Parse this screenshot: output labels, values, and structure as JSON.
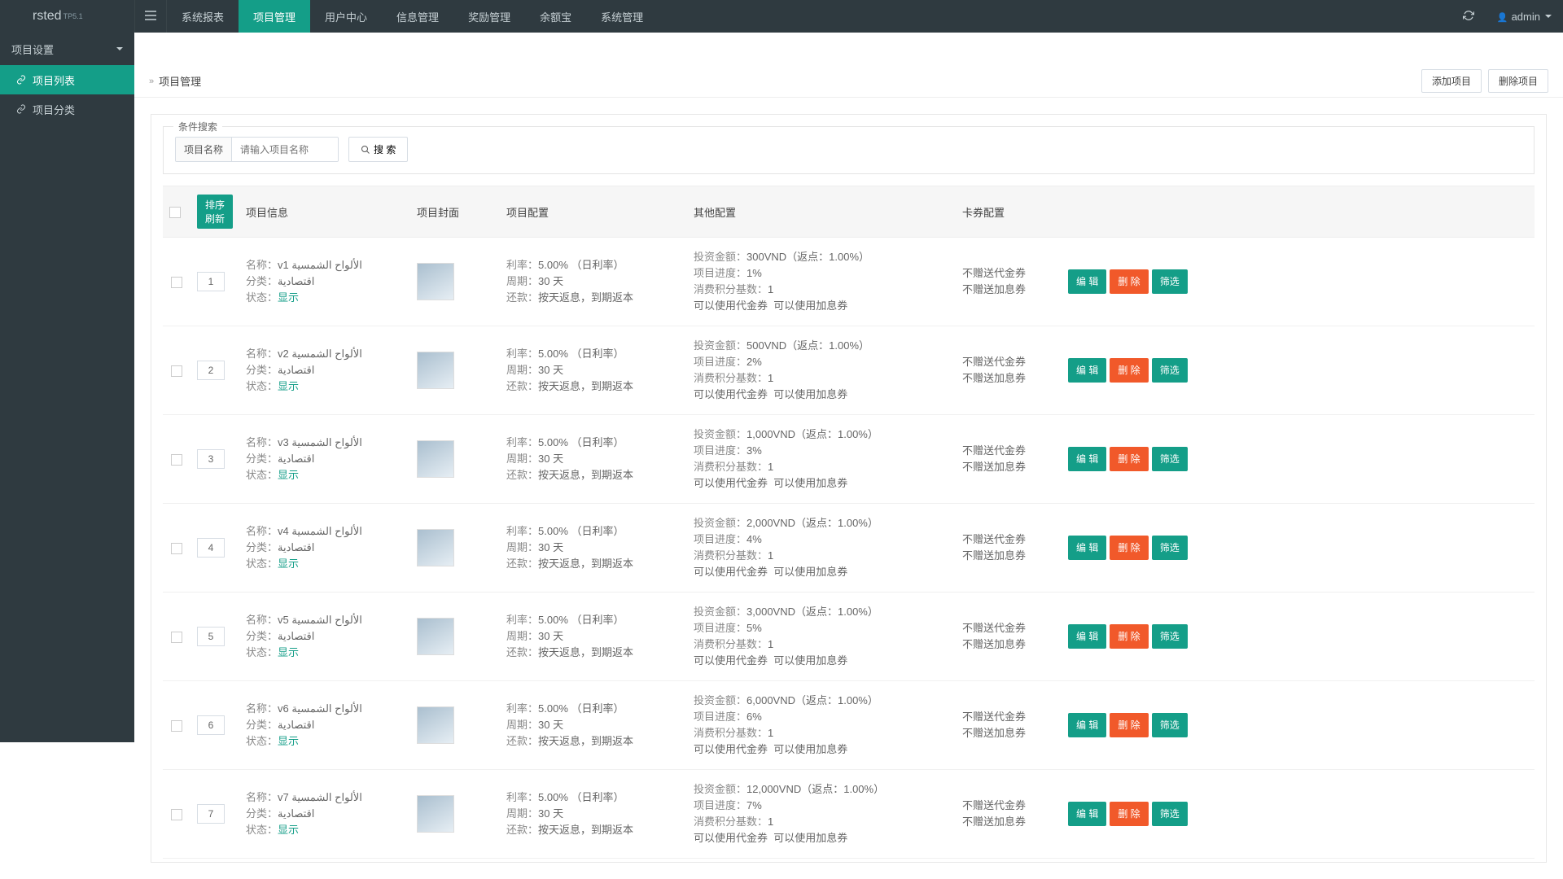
{
  "brand": {
    "name": "rsted",
    "version": "TP5.1"
  },
  "nav": {
    "items": [
      "系统报表",
      "项目管理",
      "用户中心",
      "信息管理",
      "奖励管理",
      "余额宝",
      "系统管理"
    ],
    "active_index": 1
  },
  "user": {
    "name": "admin"
  },
  "sidebar": {
    "header": "项目设置",
    "items": [
      {
        "label": "项目列表",
        "active": true
      },
      {
        "label": "项目分类",
        "active": false
      }
    ]
  },
  "breadcrumb": {
    "title": "项目管理"
  },
  "header_actions": {
    "add": "添加项目",
    "delete": "删除项目"
  },
  "search": {
    "legend": "条件搜索",
    "field_label": "项目名称",
    "placeholder": "请输入项目名称",
    "button": "搜 索"
  },
  "table": {
    "sort_refresh": "排序刷新",
    "headers": {
      "info": "项目信息",
      "cover": "项目封面",
      "config": "项目配置",
      "other": "其他配置",
      "card": "卡券配置"
    },
    "labels": {
      "name": "名称：",
      "category": "分类：",
      "status": "状态：",
      "status_show": "显示",
      "rate": "利率：",
      "rate_suffix": "（日利率）",
      "cycle": "周期：",
      "cycle_unit": " 天",
      "repay": "还款：",
      "repay_text": "按天返息，到期返本",
      "invest": "投资金额：",
      "rebate_prefix": "（返点：",
      "rebate_suffix": "）",
      "progress": "项目进度：",
      "consume": "消费积分基数：",
      "can_voucher": "可以使用代金券",
      "can_interest": "可以使用加息券",
      "no_voucher": "不赠送代金券",
      "no_interest": "不赠送加息券"
    },
    "actions": {
      "edit": "编 辑",
      "delete": "删 除",
      "filter": "筛选"
    },
    "rows": [
      {
        "sort": "1",
        "name": "الألواح الشمسية v1",
        "category": "اقتصادية",
        "rate": "5.00%",
        "cycle": "30",
        "invest": "300VND",
        "rebate": "1.00%",
        "progress": "1%",
        "consume": "1"
      },
      {
        "sort": "2",
        "name": "الألواح الشمسية v2",
        "category": "اقتصادية",
        "rate": "5.00%",
        "cycle": "30",
        "invest": "500VND",
        "rebate": "1.00%",
        "progress": "2%",
        "consume": "1"
      },
      {
        "sort": "3",
        "name": "الألواح الشمسية v3",
        "category": "اقتصادية",
        "rate": "5.00%",
        "cycle": "30",
        "invest": "1,000VND",
        "rebate": "1.00%",
        "progress": "3%",
        "consume": "1"
      },
      {
        "sort": "4",
        "name": "الألواح الشمسية v4",
        "category": "اقتصادية",
        "rate": "5.00%",
        "cycle": "30",
        "invest": "2,000VND",
        "rebate": "1.00%",
        "progress": "4%",
        "consume": "1"
      },
      {
        "sort": "5",
        "name": "الألواح الشمسية v5",
        "category": "اقتصادية",
        "rate": "5.00%",
        "cycle": "30",
        "invest": "3,000VND",
        "rebate": "1.00%",
        "progress": "5%",
        "consume": "1"
      },
      {
        "sort": "6",
        "name": "الألواح الشمسية v6",
        "category": "اقتصادية",
        "rate": "5.00%",
        "cycle": "30",
        "invest": "6,000VND",
        "rebate": "1.00%",
        "progress": "6%",
        "consume": "1"
      },
      {
        "sort": "7",
        "name": "الألواح الشمسية v7",
        "category": "اقتصادية",
        "rate": "5.00%",
        "cycle": "30",
        "invest": "12,000VND",
        "rebate": "1.00%",
        "progress": "7%",
        "consume": "1"
      }
    ]
  }
}
